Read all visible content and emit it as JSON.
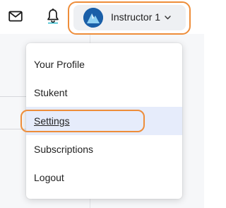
{
  "header": {
    "icons": {
      "mail": "mail-icon",
      "notifications": "bell-icon",
      "dropdown": "chevron-down-icon"
    },
    "user": {
      "name": "Instructor 1"
    }
  },
  "user_menu": {
    "items": [
      {
        "label": "Your Profile"
      },
      {
        "label": "Stukent"
      },
      {
        "label": "Settings",
        "active": true
      },
      {
        "label": "Subscriptions"
      },
      {
        "label": "Logout"
      }
    ]
  },
  "colors": {
    "highlight_ring": "#ee8d3a",
    "active_item_bg": "#e6ecfb",
    "user_chip_bg": "#eef0f3",
    "avatar_blue": "#1a5fa8"
  }
}
